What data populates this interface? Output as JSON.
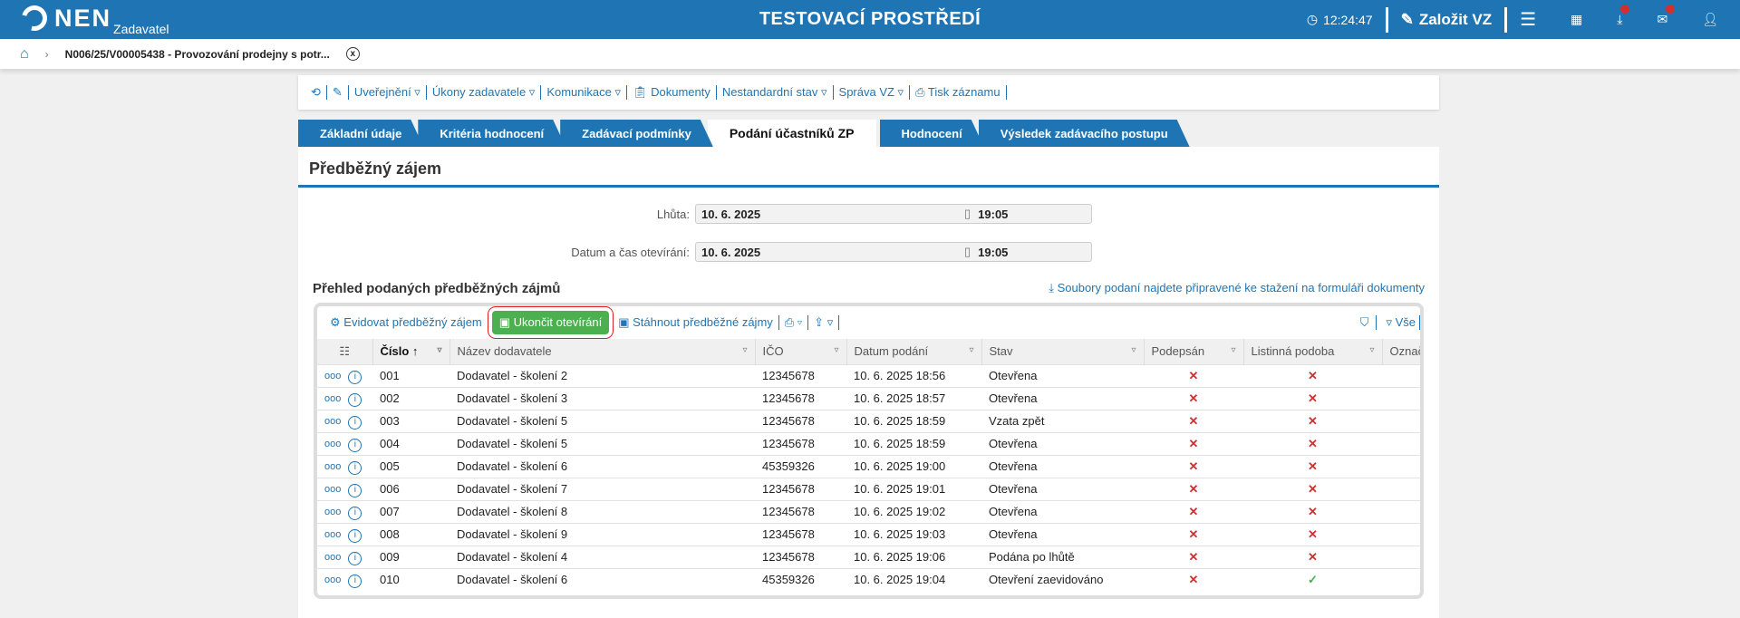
{
  "header": {
    "logo": "NEN",
    "logo_sub": "Zadavatel",
    "env": "TESTOVACÍ PROSTŘEDÍ",
    "time": "12:24:47",
    "create": "Založit VZ"
  },
  "breadcrumb": {
    "item": "N006/25/V00005438 - Provozování prodejny s potr..."
  },
  "toolbar": [
    "Uveřejnění ▿",
    "Úkony zadavatele ▿",
    "Komunikace ▿",
    "Dokumenty",
    "Nestandardní stav ▿",
    "Správa VZ ▿",
    "Tisk záznamu"
  ],
  "tabs": [
    "Základní údaje",
    "Kritéria hodnocení",
    "Zadávací podmínky",
    "Podání účastníků ZP",
    "Hodnocení",
    "Výsledek zadávacího postupu"
  ],
  "section": {
    "title": "Předběžný zájem",
    "lhuta_label": "Lhůta:",
    "lhuta_date": "10. 6. 2025",
    "lhuta_time": "19:05",
    "otev_label": "Datum a čas otevírání:",
    "otev_date": "10. 6. 2025",
    "otev_time": "19:05"
  },
  "overview": {
    "title": "Přehled podaných předběžných zájmů",
    "download_note": "Soubory podaní najdete připravené ke stažení na formuláři dokumenty",
    "btn_evidovat": "Evidovat předběžný zájem",
    "btn_ukoncit": "Ukončit otevírání",
    "btn_stahnout": "Stáhnout předběžné zájmy",
    "filter_all": "Vše"
  },
  "table": {
    "columns": [
      "Číslo",
      "Název dodavatele",
      "IČO",
      "Datum podání",
      "Stav",
      "Podepsán",
      "Listinná podoba",
      "Označe"
    ],
    "rows": [
      {
        "n": "001",
        "name": "Dodavatel - školení 2",
        "ico": "12345678",
        "date": "10. 6. 2025 18:56",
        "stav": "Otevřena",
        "sig": "✕",
        "paper": "✕"
      },
      {
        "n": "002",
        "name": "Dodavatel - školení 3",
        "ico": "12345678",
        "date": "10. 6. 2025 18:57",
        "stav": "Otevřena",
        "sig": "✕",
        "paper": "✕"
      },
      {
        "n": "003",
        "name": "Dodavatel - školení 5",
        "ico": "12345678",
        "date": "10. 6. 2025 18:59",
        "stav": "Vzata zpět",
        "sig": "✕",
        "paper": "✕"
      },
      {
        "n": "004",
        "name": "Dodavatel - školení 5",
        "ico": "12345678",
        "date": "10. 6. 2025 18:59",
        "stav": "Otevřena",
        "sig": "✕",
        "paper": "✕"
      },
      {
        "n": "005",
        "name": "Dodavatel - školení 6",
        "ico": "45359326",
        "date": "10. 6. 2025 19:00",
        "stav": "Otevřena",
        "sig": "✕",
        "paper": "✕"
      },
      {
        "n": "006",
        "name": "Dodavatel - školení 7",
        "ico": "12345678",
        "date": "10. 6. 2025 19:01",
        "stav": "Otevřena",
        "sig": "✕",
        "paper": "✕"
      },
      {
        "n": "007",
        "name": "Dodavatel - školení 8",
        "ico": "12345678",
        "date": "10. 6. 2025 19:02",
        "stav": "Otevřena",
        "sig": "✕",
        "paper": "✕"
      },
      {
        "n": "008",
        "name": "Dodavatel - školení 9",
        "ico": "12345678",
        "date": "10. 6. 2025 19:03",
        "stav": "Otevřena",
        "sig": "✕",
        "paper": "✕"
      },
      {
        "n": "009",
        "name": "Dodavatel - školení 4",
        "ico": "12345678",
        "date": "10. 6. 2025 19:06",
        "stav": "Podána po lhůtě",
        "sig": "✕",
        "paper": "✕"
      },
      {
        "n": "010",
        "name": "Dodavatel - školení 6",
        "ico": "45359326",
        "date": "10. 6. 2025 19:04",
        "stav": "Otevření zaevidováno",
        "sig": "✕",
        "paper": "✓"
      }
    ]
  }
}
